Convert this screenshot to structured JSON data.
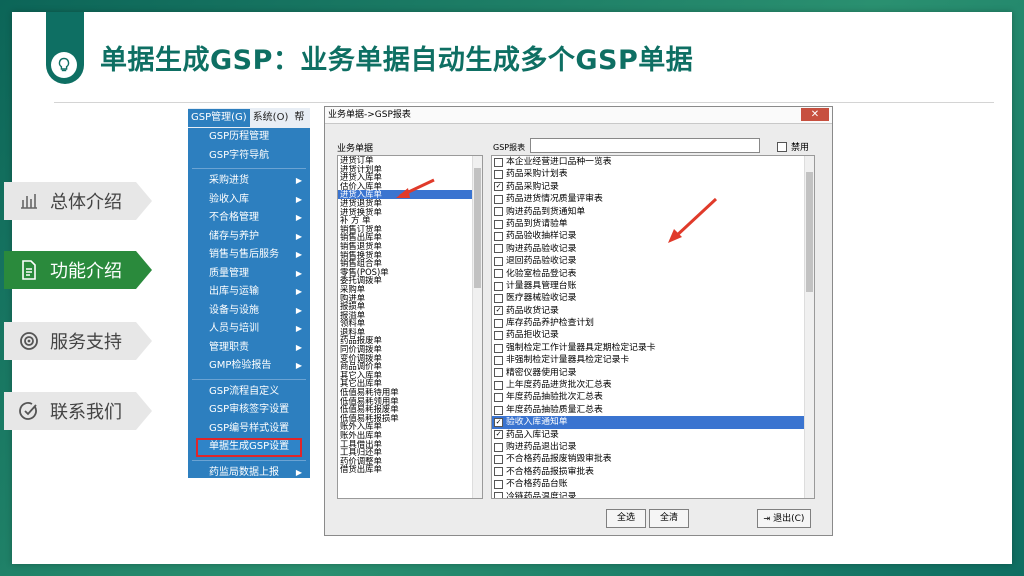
{
  "slide": {
    "title": "单据生成GSP：业务单据自动生成多个GSP单据",
    "icon": "lightbulb-icon"
  },
  "nav": [
    {
      "label": "总体介绍",
      "icon": "chart-icon",
      "active": false
    },
    {
      "label": "功能介绍",
      "icon": "document-icon",
      "active": true
    },
    {
      "label": "服务支持",
      "icon": "target-icon",
      "active": false
    },
    {
      "label": "联系我们",
      "icon": "check-circle-icon",
      "active": false
    }
  ],
  "menu": {
    "bar": [
      "GSP管理(G)",
      "系统(O)",
      "帮"
    ],
    "items_top": [
      "GSP历程管理",
      "GSP字符导航"
    ],
    "items_mid": [
      "采购进货",
      "验收入库",
      "不合格管理",
      "储存与养护",
      "销售与售后服务",
      "质量管理",
      "出库与运输",
      "设备与设施",
      "人员与培训",
      "管理职责",
      "GMP检验报告"
    ],
    "items_bottom": [
      "GSP流程自定义",
      "GSP审核签字设置",
      "GSP编号样式设置",
      "单据生成GSP设置"
    ],
    "items_last": [
      "药监局数据上报"
    ]
  },
  "dialog": {
    "title": "业务单据->GSP报表",
    "close": "✕",
    "left_label": "业务单据",
    "gsp_label": "GSP报表",
    "disable_label": "禁用",
    "business_docs": [
      "进货订单",
      "进货计划单",
      "进货入库单",
      "估价入库单",
      "进货入库单",
      "进货退货单",
      "进货换货单",
      "补 方 单",
      "销售订货单",
      "销售出库单",
      "销售退货单",
      "销售换货单",
      "销售组合单",
      "零售(POS)单",
      "委托调拨单",
      "采购单",
      "购进单",
      "报损单",
      "报溢单",
      "领料单",
      "退料单",
      "药品报废单",
      "同价调拨单",
      "变价调拨单",
      "商品调价单",
      "其它入库单",
      "其它出库单",
      "低值易耗待用单",
      "低值易耗领用单",
      "低值易耗报废单",
      "低值易耗报损单",
      "账外入库单",
      "账外出库单",
      "工具借出单",
      "工具归还单",
      "药价调整单",
      "借货出库单"
    ],
    "selected_doc_index": 4,
    "gsp_reports": [
      {
        "label": "本企业经营进口品种一览表",
        "checked": false
      },
      {
        "label": "药品采购计划表",
        "checked": false
      },
      {
        "label": "药品采购记录",
        "checked": true
      },
      {
        "label": "药品进货情况质量评审表",
        "checked": false
      },
      {
        "label": "购进药品到货通知单",
        "checked": false
      },
      {
        "label": "药品到货请验单",
        "checked": false
      },
      {
        "label": "药品验收抽样记录",
        "checked": false
      },
      {
        "label": "购进药品验收记录",
        "checked": false
      },
      {
        "label": "退回药品验收记录",
        "checked": false
      },
      {
        "label": "化验室检品登记表",
        "checked": false
      },
      {
        "label": "计量器具管理台账",
        "checked": false
      },
      {
        "label": "医疗器械验收记录",
        "checked": false
      },
      {
        "label": "药品收货记录",
        "checked": true
      },
      {
        "label": "库存药品养护检查计划",
        "checked": false
      },
      {
        "label": "药品拒收记录",
        "checked": false
      },
      {
        "label": "强制检定工作计量器具定期检定记录卡",
        "checked": false
      },
      {
        "label": "非强制检定计量器具检定记录卡",
        "checked": false
      },
      {
        "label": "精密仪器使用记录",
        "checked": false
      },
      {
        "label": "上年度药品进货批次汇总表",
        "checked": false
      },
      {
        "label": "年度药品抽验批次汇总表",
        "checked": false
      },
      {
        "label": "年度药品抽验质量汇总表",
        "checked": false
      },
      {
        "label": "验收入库通知单",
        "checked": true
      },
      {
        "label": "药品入库记录",
        "checked": true
      },
      {
        "label": "购进药品退出记录",
        "checked": false
      },
      {
        "label": "不合格药品报废销毁审批表",
        "checked": false
      },
      {
        "label": "不合格药品报损审批表",
        "checked": false
      },
      {
        "label": "不合格药品台账",
        "checked": false
      },
      {
        "label": "冷链药品温度记录",
        "checked": false
      }
    ],
    "selected_report_index": 21,
    "buttons": {
      "select_all": "全选",
      "clear_all": "全清",
      "exit": "退出(C)"
    }
  },
  "colors": {
    "brand": "#0e6f63",
    "active_nav": "#2a8a3c",
    "menu_bg": "#2d7fbf",
    "highlight_box": "#e0262a",
    "annotation_arrow": "#e03a2a"
  }
}
